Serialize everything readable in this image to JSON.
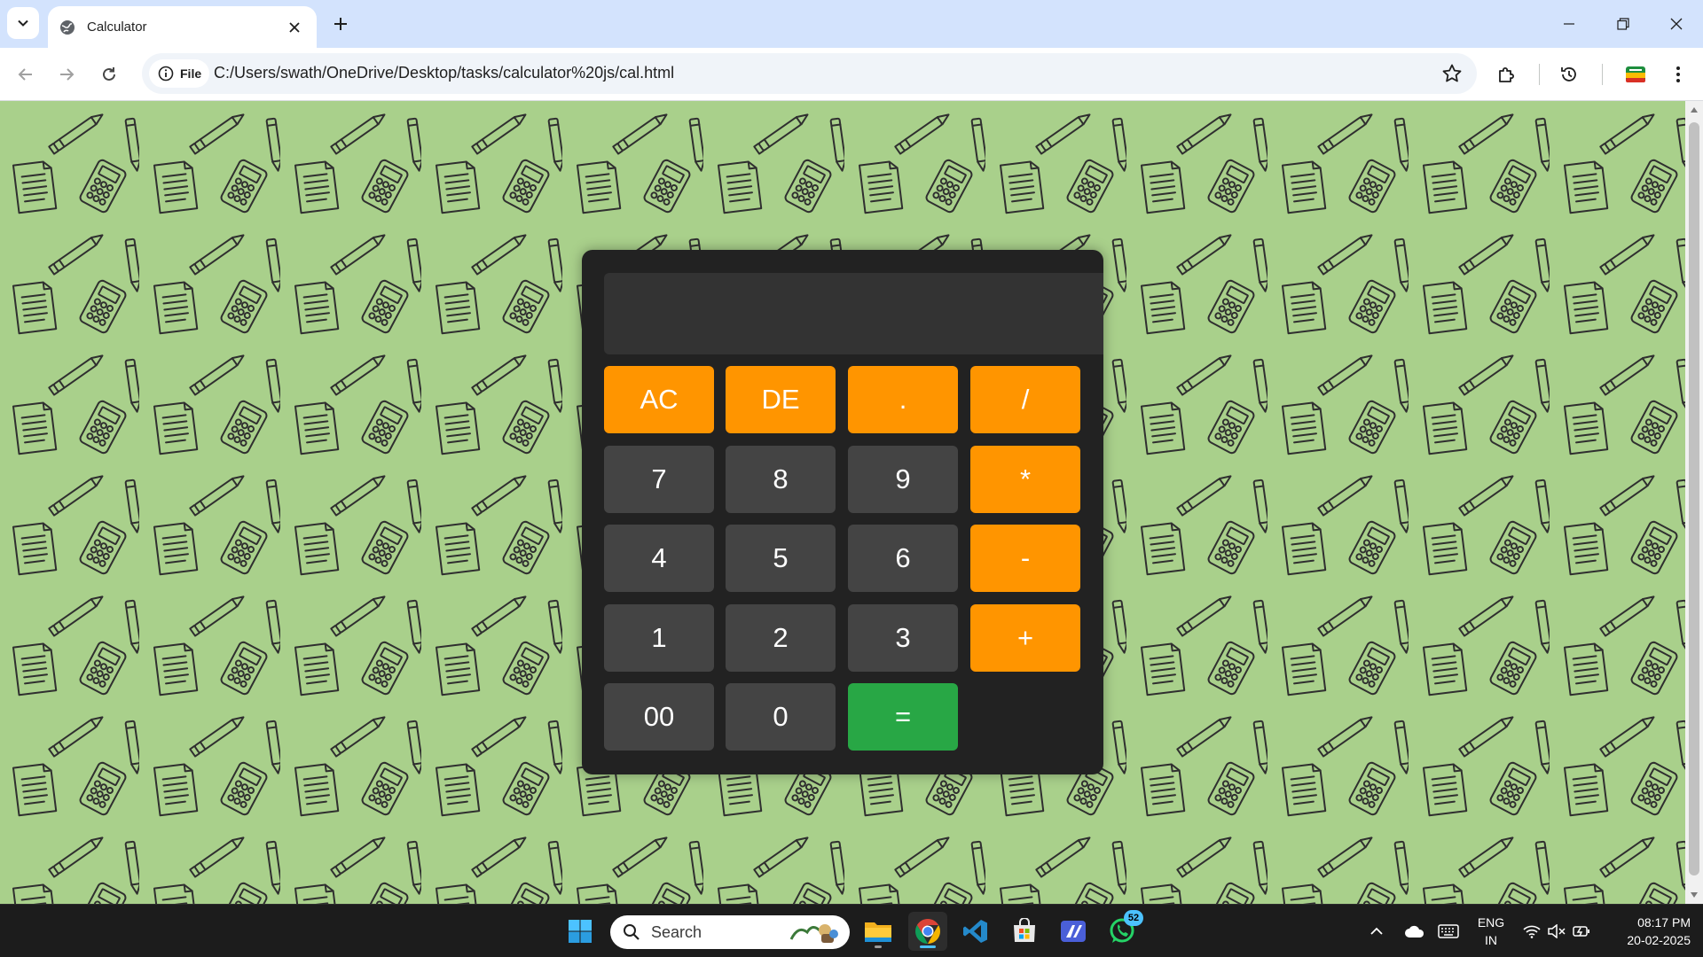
{
  "browser": {
    "tab": {
      "title": "Calculator"
    },
    "address": {
      "scheme_chip": "File",
      "url": "C:/Users/swath/OneDrive/Desktop/tasks/calculator%20js/cal.html"
    }
  },
  "calculator": {
    "display_value": "",
    "keys": [
      [
        "AC",
        "DE",
        ".",
        "/"
      ],
      [
        "7",
        "8",
        "9",
        "*"
      ],
      [
        "4",
        "5",
        "6",
        "-"
      ],
      [
        "1",
        "2",
        "3",
        "+"
      ],
      [
        "00",
        "0",
        "="
      ]
    ],
    "colors": {
      "panel": "#222222",
      "display": "#333333",
      "digit": "#444444",
      "operator": "#ff9500",
      "equals": "#28a745",
      "page_background": "#a9d08b"
    }
  },
  "taskbar": {
    "search_placeholder": "Search",
    "whatsapp_badge": "52",
    "language": {
      "line1": "ENG",
      "line2": "IN"
    },
    "time": "08:17 PM",
    "date": "20-02-2025",
    "pinned_icons": [
      "windows-start-icon",
      "file-explorer-icon",
      "chrome-icon",
      "vscode-icon",
      "microsoft-store-icon",
      "app-icon",
      "whatsapp-icon"
    ]
  }
}
